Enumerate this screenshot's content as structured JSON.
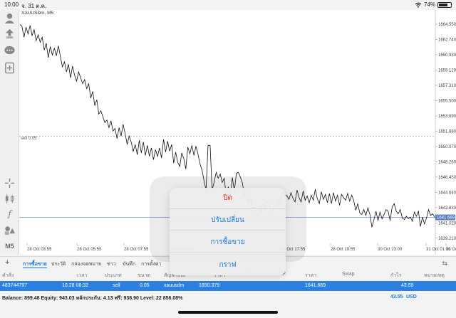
{
  "status_bar": {
    "time": "10:00",
    "date": "จ. 31 ต.ค.",
    "battery": "74%",
    "battery_level": 0.74
  },
  "toolbar": {
    "icons": [
      "account-icon",
      "trade-arrows-icon",
      "chat-icon",
      "new-order-icon",
      "crosshair-icon",
      "candle-type-icon",
      "indicator-icon",
      "objects-icon",
      "timeframe"
    ],
    "timeframe_label": "M5"
  },
  "chart": {
    "symbol_label": "XAUUSDm, M5",
    "sell_label": "sell 0.05",
    "current_price_tag": "1641.669",
    "line_color": "#111111",
    "sell_level_color": "#888888",
    "current_price_color": "#5b7fc4"
  },
  "chart_data": {
    "type": "line",
    "series": [
      {
        "values": [
          1664.5,
          1664.3,
          1663.0,
          1664.2,
          1663.4,
          1664.4,
          1663.2,
          1663.9,
          1662.6,
          1663.3,
          1662.4,
          1663.0,
          1661.5,
          1662.3,
          1660.6,
          1661.9,
          1660.9,
          1661.7,
          1660.8,
          1662.0,
          1660.7,
          1659.5,
          1660.1,
          1658.9,
          1659.8,
          1658.2,
          1659.6,
          1658.5,
          1657.8,
          1658.9,
          1658.2,
          1657.5,
          1658.0,
          1656.9,
          1657.5,
          1655.8,
          1656.6,
          1654.9,
          1655.6,
          1653.9,
          1654.3,
          1653.6,
          1652.9,
          1653.2,
          1652.3,
          1653.1,
          1651.9,
          1652.2,
          1651.0,
          1652.3,
          1651.3,
          1652.7,
          1651.6,
          1650.3,
          1651.3,
          1650.6,
          1649.5,
          1650.3,
          1649.1,
          1650.8,
          1649.3,
          1650.6,
          1649.0,
          1650.2,
          1648.9,
          1649.9,
          1648.5,
          1649.7,
          1648.9,
          1649.9,
          1648.7,
          1650.9,
          1649.4,
          1650.7,
          1649.5,
          1650.3,
          1648.1,
          1649.4,
          1648.2,
          1647.7,
          1649.3,
          1648.6,
          1647.4,
          1650.0,
          1649.2,
          1650.2,
          1649.0,
          1650.1,
          1649.2,
          1648.0,
          1647.3,
          1646.0,
          1644.9,
          1650.2,
          1650.2,
          1644.9,
          1645.8,
          1647.0,
          1646.3,
          1646.8,
          1645.8,
          1646.3,
          1644.2,
          1645.3,
          1644.1,
          1646.4,
          1644.8,
          1646.9,
          1647.0,
          1646.4,
          1645.7,
          1644.2,
          1644.6,
          1643.4,
          1643.9,
          1642.8,
          1642.9,
          1642.2,
          1641.7,
          1642.5,
          1643.3,
          1642.7,
          1643.5,
          1643.4,
          1642.3,
          1642.5,
          1642.8,
          1643.1,
          1643.3,
          1644.1,
          1644.8,
          1644.4,
          1644.2,
          1643.8,
          1644.6,
          1643.9,
          1643.5,
          1644.9,
          1644.0,
          1643.5,
          1644.8,
          1643.7,
          1644.2,
          1643.4,
          1644.3,
          1643.7,
          1645.0,
          1643.9,
          1643.3,
          1644.7,
          1643.8,
          1644.4,
          1643.4,
          1644.5,
          1643.3,
          1644.6,
          1643.6,
          1644.3,
          1643.1,
          1644.4,
          1644.0,
          1643.7,
          1644.5,
          1643.6,
          1644.3,
          1643.7,
          1642.5,
          1643.3,
          1642.2,
          1642.0,
          1642.6,
          1641.9,
          1642.8,
          1642.0,
          1640.5,
          1641.4,
          1642.4,
          1641.3,
          1642.3,
          1641.5,
          1642.0,
          1642.6,
          1642.4,
          1641.3,
          1642.9,
          1643.3,
          1642.4,
          1642.1,
          1642.6,
          1641.6,
          1641.4,
          1641.8,
          1641.5,
          1641.7,
          1641.2,
          1642.3,
          1641.8,
          1642.4,
          1640.6,
          1641.7,
          1640.9,
          1641.6,
          1642.6,
          1641.9,
          1642.1,
          1641.7
        ]
      }
    ],
    "y_ticks": [
      "1664.550",
      "1662.740",
      "1660.930",
      "1659.120",
      "1657.310",
      "1655.500",
      "1653.690",
      "1651.880",
      "1650.070",
      "1648.260",
      "1646.450",
      "1644.640",
      "1642.830",
      "1641.020",
      "1639.210"
    ],
    "x_ticks": [
      "28 Oct 03:55",
      "28 Oct 05:55",
      "28 Oct 07:55",
      "28 Oct 09:55",
      "28 Oct 17:55",
      "28 Oct 19:55",
      "30 Oct 23:00",
      "31 Oct 01:00",
      "31 Oct 03:00"
    ],
    "ylim": [
      1638.6,
      1665.9
    ],
    "sell_level": 1651.3,
    "current_price": 1641.669,
    "grid": false
  },
  "tabs": {
    "add_label": "+",
    "items": [
      "การซื้อขาย",
      "ประวัติ",
      "กล่องจดหมาย",
      "ข่าว",
      "บันทึก",
      "การตั้งค่า"
    ]
  },
  "table": {
    "headers": [
      "คำสั่ง",
      "เวลา",
      "ประเภท",
      "ขนาด",
      "สัญลักษณ์",
      "ราคา",
      "S/L",
      "T/P",
      "ราคา",
      "Swap",
      "กำไร",
      "หมายเหตุ"
    ],
    "row": {
      "order": "483744797",
      "time": "10.28 08:32",
      "type": "sell",
      "size": "0.05",
      "symbol": "xauusdm",
      "open_price": "1650.379",
      "price": "1641.669",
      "profit": "43.55"
    }
  },
  "balance": {
    "summary": "Balance: 899.48 Equity: 943.03 หลักประกัน: 4.13 ฟรี: 938.90 Level: 22 856.08%",
    "profit": "43.55",
    "currency": "USD"
  },
  "popup": {
    "close_label": "ปิด",
    "modify_label": "ปรับเปลี่ยน",
    "trade_label": "การซื้อขาย",
    "chart_label": "กราฟ"
  }
}
